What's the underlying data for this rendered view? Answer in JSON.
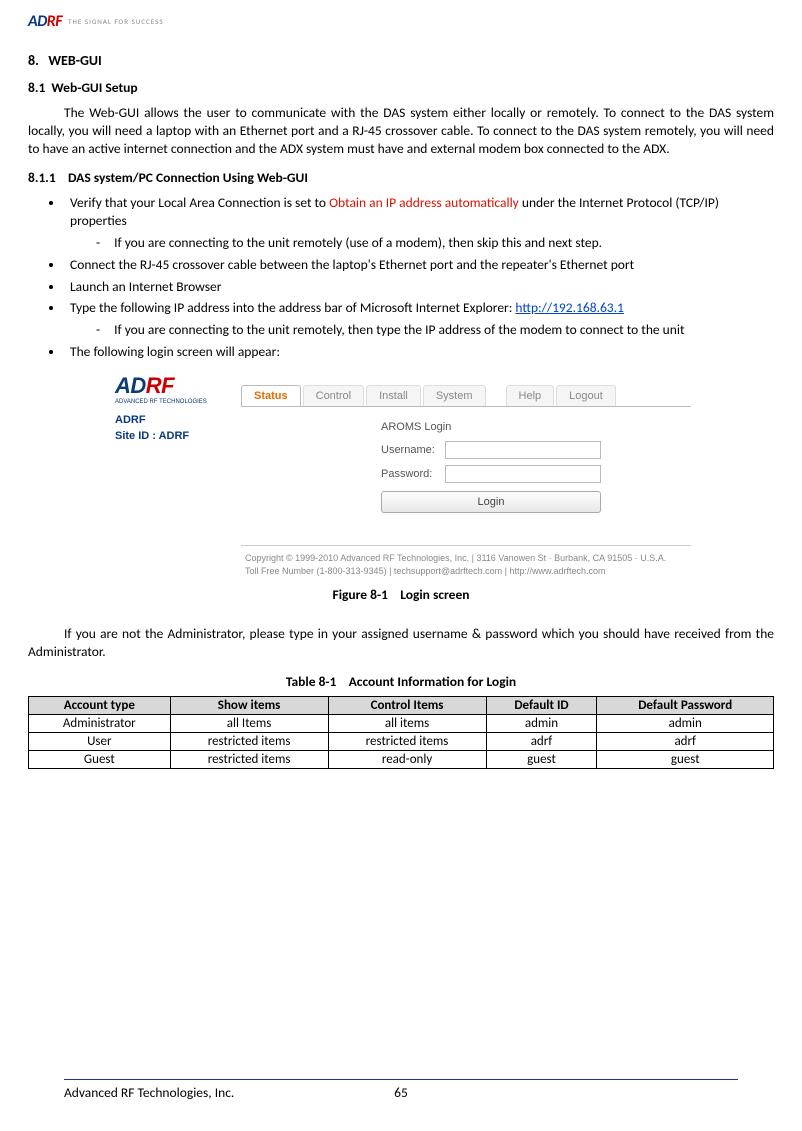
{
  "header": {
    "logo_left": "AD",
    "logo_f": "RF",
    "tagline": "THE SIGNAL FOR SUCCESS"
  },
  "section": {
    "num": "8.",
    "title": "WEB-GUI",
    "sub1_num": "8.1",
    "sub1_title": "Web-GUI Setup",
    "para1": "The Web-GUI allows the user to communicate with the DAS system either locally or remotely.  To connect to the DAS system locally, you will need a laptop with an Ethernet port and a RJ-45 crossover cable.  To connect to the DAS system remotely, you will need to have an active internet connection and the ADX system must have and external modem box connected to the ADX.",
    "sub11_num": "8.1.1",
    "sub11_title": "DAS system/PC Connection Using Web-GUI"
  },
  "bullets": [
    {
      "pre": "Verify that your Local Area Connection is set to ",
      "hl": "Obtain an IP address automatically",
      "post": " under the Internet Protocol (TCP/IP) properties",
      "dash": "If you are connecting to the unit remotely (use of a modem), then skip this and next step."
    },
    {
      "text": "Connect the RJ-45 crossover cable between the laptop's Ethernet port and the repeater's Ethernet port"
    },
    {
      "text": "Launch an Internet Browser"
    },
    {
      "pre": "Type the following IP address into the address bar of Microsoft Internet Explorer: ",
      "link": "http://192.168.63.1",
      "dash": "If you are connecting to the unit remotely, then type the IP address of the modem to connect to the unit"
    },
    {
      "text": "The following login screen will appear:"
    }
  ],
  "screenshot": {
    "logo": {
      "part1": "AD",
      "part2": "RF",
      "sub": "ADVANCED RF TECHNOLOGIES"
    },
    "info_line1": "ADRF",
    "info_line2": "Site ID : ADRF",
    "tabs": [
      "Status",
      "Control",
      "Install",
      "System",
      "Help",
      "Logout"
    ],
    "login_title": "AROMS Login",
    "username_label": "Username:",
    "password_label": "Password:",
    "login_btn": "Login",
    "footer1": "Copyright © 1999-2010 Advanced RF Technologies, Inc. | 3116 Vanowen St · Burbank, CA 91505 · U.S.A.",
    "footer2": "Toll Free Number (1-800-313-9345) | techsupport@adrftech.com | http://www.adrftech.com"
  },
  "figure_caption_num": "Figure 8-1",
  "figure_caption_text": "Login screen",
  "para2": "If you are not the Administrator, please type in your assigned username & password which you should have received from the Administrator.",
  "table_caption_num": "Table 8-1",
  "table_caption_text": "Account Information for Login",
  "table": {
    "headers": [
      "Account type",
      "Show items",
      "Control Items",
      "Default ID",
      "Default Password"
    ],
    "rows": [
      [
        "Administrator",
        "all Items",
        "all items",
        "admin",
        "admin"
      ],
      [
        "User",
        "restricted items",
        "restricted items",
        "adrf",
        "adrf"
      ],
      [
        "Guest",
        "restricted items",
        "read-only",
        "guest",
        "guest"
      ]
    ]
  },
  "footer": {
    "company": "Advanced RF Technologies, Inc.",
    "page": "65"
  }
}
